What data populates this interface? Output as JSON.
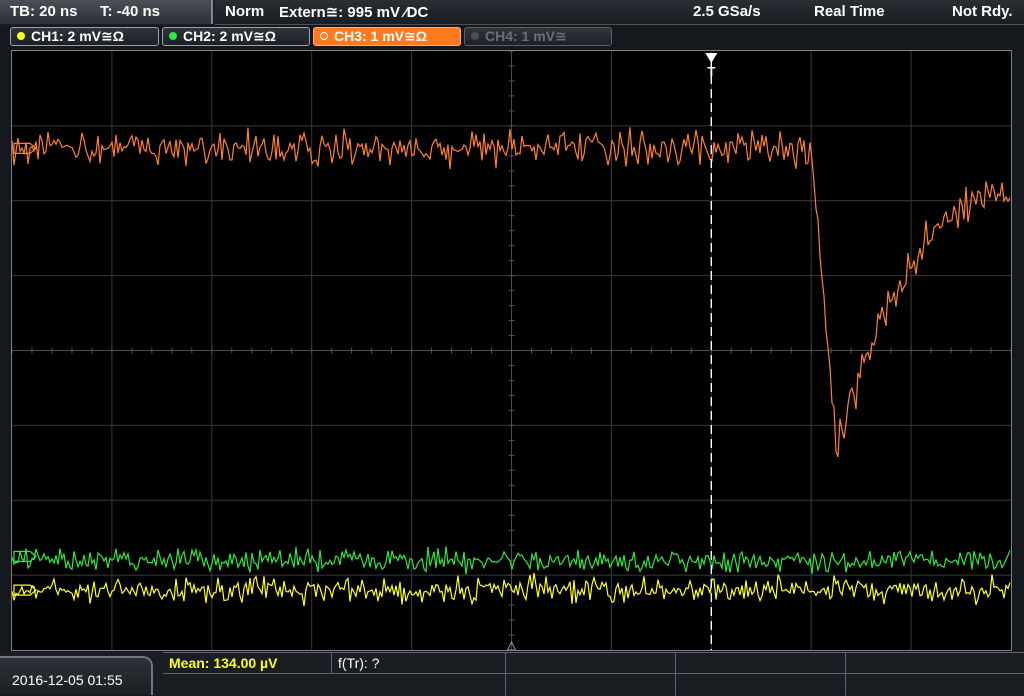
{
  "timebase": {
    "tb": "TB: 20 ns",
    "t": "T: -40 ns"
  },
  "trigger": {
    "mode": "Norm",
    "source": "Extern≅: 995 mV ⁄DC",
    "sample_rate": "2.5 GSa/s",
    "acq_mode": "Real Time",
    "status": "Not Rdy."
  },
  "channels": [
    {
      "label": "CH1: 2 mV≅Ω",
      "color": "#ffff20",
      "active": false,
      "enabled": true
    },
    {
      "label": "CH2: 2 mV≅Ω",
      "color": "#2ee840",
      "active": false,
      "enabled": true
    },
    {
      "label": "CH3: 1 mV≅Ω",
      "color": "#ff8030",
      "active": true,
      "enabled": true
    },
    {
      "label": "CH4: 1 mV≅",
      "color": "#5a6067",
      "active": false,
      "enabled": false
    }
  ],
  "trigger_marker": "T",
  "datetime": "2016-12-05 01:55",
  "measurements": {
    "mean": "Mean: 134.00 µV",
    "freq": "f(Tr): ?"
  },
  "colors": {
    "ch1": "#ffff20",
    "ch2": "#2ee840",
    "ch3": "#ff8030",
    "grid": "#3a3a3a",
    "screen_bg": "#000000"
  },
  "chart_data": {
    "type": "line",
    "grid": {
      "x_divisions": 10,
      "y_divisions": 8
    },
    "trigger_position_div": 7,
    "series": [
      {
        "channel": "CH3",
        "baseline_div": 1.3,
        "noise_div": 0.33,
        "pulse_start_div": 8.0,
        "pulse_min_div": 5.3,
        "pulse_min_at_div": 8.25,
        "end_level_div": 1.9
      },
      {
        "channel": "CH2",
        "baseline_div": 6.8,
        "noise_div": 0.22
      },
      {
        "channel": "CH1",
        "baseline_div": 7.2,
        "noise_div": 0.24
      }
    ]
  }
}
